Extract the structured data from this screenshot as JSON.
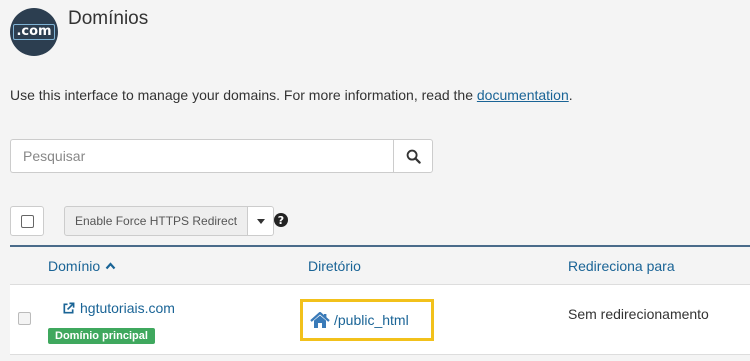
{
  "header": {
    "logo_text": ".com",
    "title": "Domínios"
  },
  "intro": {
    "text": "Use this interface to manage your domains. For more information, read the ",
    "link": "documentation",
    "suffix": "."
  },
  "search": {
    "placeholder": "Pesquisar",
    "value": ""
  },
  "toolbar": {
    "force_https_label": "Enable Force HTTPS Redirect",
    "help_symbol": "?"
  },
  "table": {
    "columns": {
      "domain": "Domínio",
      "directory": "Diretório",
      "redirect": "Redireciona para"
    },
    "rows": [
      {
        "domain": "hgtutoriais.com",
        "badge": "Domínio principal",
        "directory": "/public_html",
        "redirect": "Sem redirecionamento"
      }
    ]
  },
  "colors": {
    "link": "#1a6496",
    "badge": "#3fa85e",
    "highlight": "#f2c11b",
    "header_border": "#4a6b8a"
  },
  "icons": [
    "domain-logo-icon",
    "search-icon",
    "chevron-down-icon",
    "help-icon",
    "sort-up-icon",
    "external-link-icon",
    "home-icon"
  ]
}
